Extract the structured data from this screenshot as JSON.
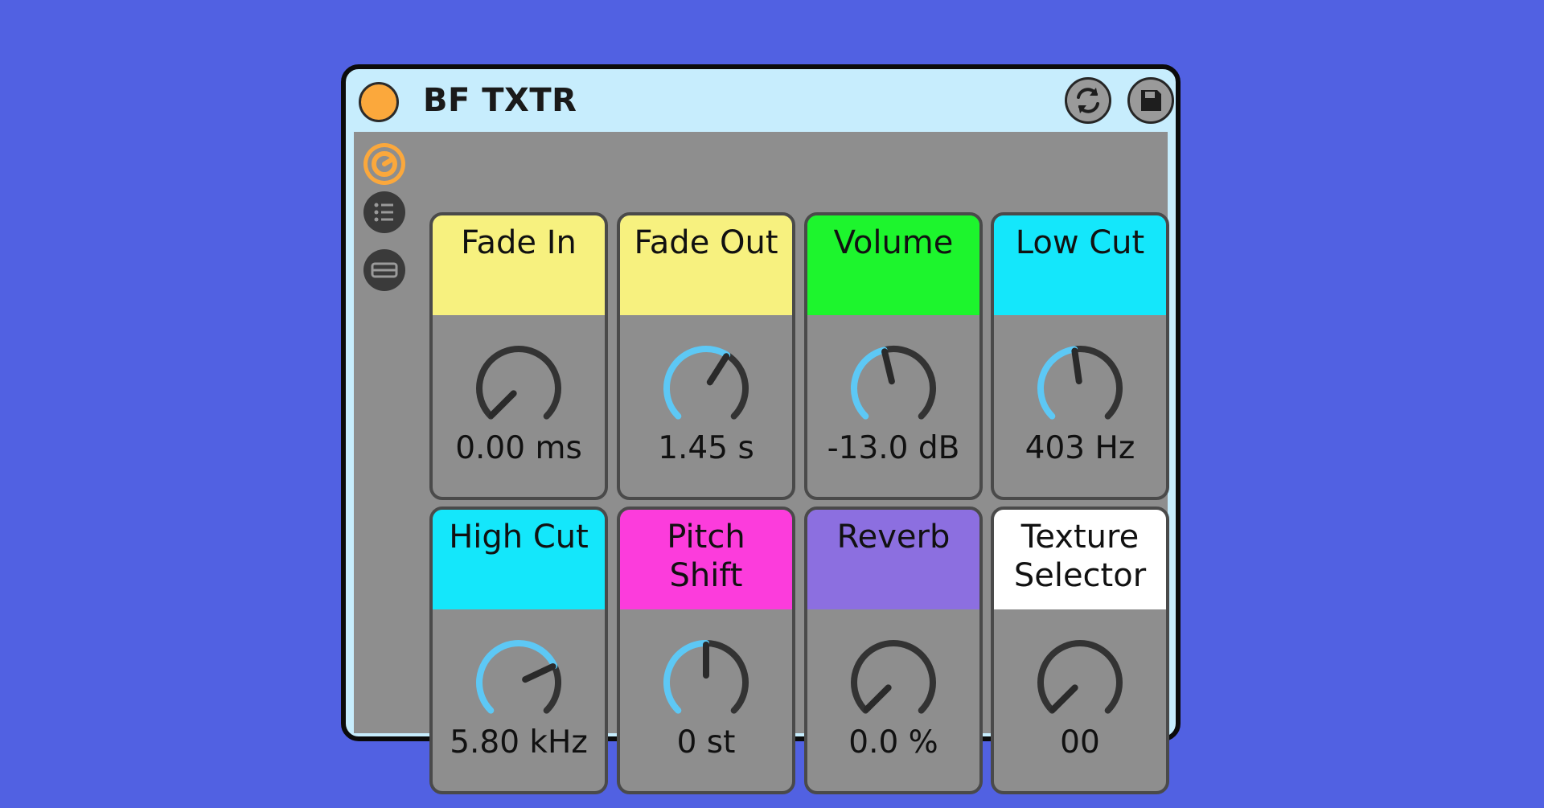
{
  "app": {
    "title": "BF TXTR"
  },
  "colors": {
    "background": "#5161E2",
    "title_bar": "#C7EDFD",
    "panel": "#8E8E8E",
    "power_on": "#FBA83C",
    "knob_arc_active": "#5DC8F5",
    "knob_arc_track": "#333333",
    "knob_pointer": "#2a2a2a"
  },
  "toolbar": {
    "refresh_icon": "refresh-arrows-icon",
    "save_icon": "floppy-disk-icon"
  },
  "sidebar": {
    "items": [
      {
        "name": "macro-view",
        "icon": "macro-knob-icon",
        "active": true
      },
      {
        "name": "list-view",
        "icon": "list-icon",
        "active": false
      },
      {
        "name": "variations-view",
        "icon": "bar-icon",
        "active": false
      }
    ]
  },
  "macros": [
    {
      "label": "Fade In",
      "value": "0.00 ms",
      "color": "#F7F17F",
      "level": 0.0
    },
    {
      "label": "Fade Out",
      "value": "1.45 s",
      "color": "#F7F17F",
      "level": 0.62
    },
    {
      "label": "Volume",
      "value": "-13.0 dB",
      "color": "#1DF52D",
      "level": 0.45
    },
    {
      "label": "Low Cut",
      "value": "403 Hz",
      "color": "#14E7FB",
      "level": 0.47
    },
    {
      "label": "High Cut",
      "value": "5.80 kHz",
      "color": "#14E7FB",
      "level": 0.74
    },
    {
      "label": "Pitch\nShift",
      "value": "0 st",
      "color": "#FC3CDC",
      "level": 0.5
    },
    {
      "label": "Reverb",
      "value": "0.0 %",
      "color": "#8C6FE0",
      "level": 0.0
    },
    {
      "label": "Texture\nSelector",
      "value": "00",
      "color": "#FFFFFF",
      "level": 0.0
    }
  ]
}
